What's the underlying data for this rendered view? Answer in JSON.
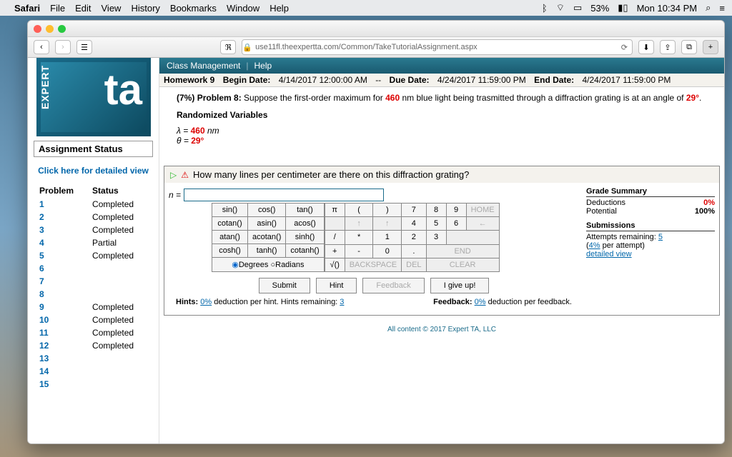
{
  "menubar": {
    "app": "Safari",
    "items": [
      "File",
      "Edit",
      "View",
      "History",
      "Bookmarks",
      "Window",
      "Help"
    ],
    "battery": "53%",
    "clock": "Mon 10:34 PM"
  },
  "browser": {
    "url": "use11fl.theexpertta.com/Common/TakeTutorialAssignment.aspx"
  },
  "sidebar": {
    "logo_brand": "EXPERT",
    "logo_ta": "ta",
    "assignment_status": "Assignment Status",
    "detail_link": "Click here for detailed view",
    "col_problem": "Problem",
    "col_status": "Status",
    "problems": [
      {
        "n": "1",
        "s": "Completed"
      },
      {
        "n": "2",
        "s": "Completed"
      },
      {
        "n": "3",
        "s": "Completed"
      },
      {
        "n": "4",
        "s": "Partial"
      },
      {
        "n": "5",
        "s": "Completed"
      },
      {
        "n": "6",
        "s": ""
      },
      {
        "n": "7",
        "s": ""
      },
      {
        "n": "8",
        "s": ""
      },
      {
        "n": "9",
        "s": "Completed"
      },
      {
        "n": "10",
        "s": "Completed"
      },
      {
        "n": "11",
        "s": "Completed"
      },
      {
        "n": "12",
        "s": "Completed"
      },
      {
        "n": "13",
        "s": ""
      },
      {
        "n": "14",
        "s": ""
      },
      {
        "n": "15",
        "s": ""
      }
    ]
  },
  "appmenu": {
    "class_management": "Class Management",
    "help": "Help"
  },
  "hw": {
    "title": "Homework 9",
    "begin_label": "Begin Date:",
    "begin": "4/14/2017 12:00:00 AM",
    "sep": "--",
    "due_label": "Due Date:",
    "due": "4/24/2017 11:59:00 PM",
    "end_label": "End Date:",
    "end": "4/24/2017 11:59:00 PM"
  },
  "problem": {
    "pct": "(7%)",
    "label": "Problem 8:",
    "text1": "Suppose the first-order maximum for ",
    "lambda": "460",
    "text2": " nm blue light being trasmitted through a diffraction grating is at an angle of ",
    "angle": "29°",
    "period": ".",
    "rand_title": "Randomized Variables",
    "var1_pre": "λ = ",
    "var1_val": "460",
    "var1_post": " nm",
    "var2_pre": "θ = ",
    "var2_val": "29°"
  },
  "question": {
    "text": "How many lines per centimeter are there on this diffraction grating?",
    "lhs": "n = "
  },
  "calc": {
    "funcs": [
      [
        "sin()",
        "cos()",
        "tan()"
      ],
      [
        "cotan()",
        "asin()",
        "acos()"
      ],
      [
        "atan()",
        "acotan()",
        "sinh()"
      ],
      [
        "cosh()",
        "tanh()",
        "cotanh()"
      ]
    ],
    "mode_deg": "Degrees",
    "mode_rad": "Radians",
    "keys": [
      [
        "π",
        "(",
        ")",
        "7",
        "8",
        "9",
        "HOME"
      ],
      [
        "",
        "↑",
        "↑",
        "4",
        "5",
        "6",
        "←"
      ],
      [
        "/",
        "*",
        "1",
        "2",
        "3",
        ""
      ],
      [
        "+",
        "-",
        "0",
        ".",
        "END"
      ],
      [
        "√()",
        "BACKSPACE",
        "DEL",
        "CLEAR"
      ]
    ]
  },
  "actions": {
    "submit": "Submit",
    "hint": "Hint",
    "feedback": "Feedback",
    "giveup": "I give up!"
  },
  "hints": {
    "label": "Hints:",
    "ded": "0%",
    "text": " deduction per hint. Hints remaining: ",
    "remaining": "3",
    "fb_label": "Feedback:",
    "fb_ded": "0%",
    "fb_text": " deduction per feedback."
  },
  "grade": {
    "title": "Grade Summary",
    "ded_label": "Deductions",
    "ded_val": "0%",
    "pot_label": "Potential",
    "pot_val": "100%",
    "sub_title": "Submissions",
    "att_label": "Attempts remaining: ",
    "att_val": "5",
    "per_label": "(",
    "per_val": "4%",
    "per_text": " per attempt)",
    "detail": "detailed view"
  },
  "footer": "All content © 2017 Expert TA, LLC"
}
